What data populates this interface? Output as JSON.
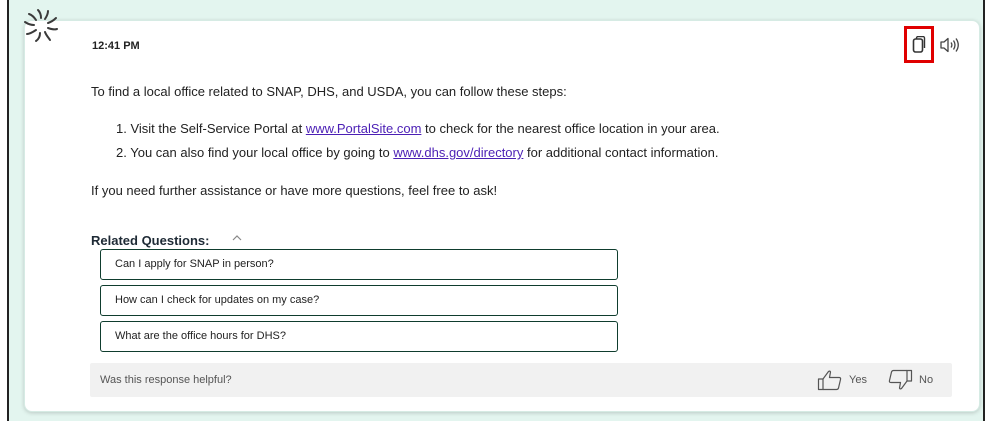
{
  "message": {
    "time": "12:41 PM",
    "intro": "To find a local office related to SNAP, DHS, and USDA, you can follow these steps:",
    "steps": [
      {
        "num": "1.",
        "before": "Visit the Self-Service Portal at ",
        "link": "www.PortalSite.com",
        "after": " to check for the nearest office location in your area."
      },
      {
        "num": "2.",
        "before": "You can also find your local office by going to ",
        "link": "www.dhs.gov/directory",
        "after": " for additional contact information."
      }
    ],
    "outro": "If you need further assistance or have more questions, feel free to ask!"
  },
  "related": {
    "title": "Related Questions:",
    "questions": [
      "Can I apply for SNAP in person?",
      "How can I check for updates on my case?",
      "What are the office hours for DHS?"
    ]
  },
  "feedback": {
    "prompt": "Was this response helpful?",
    "yes_label": "Yes",
    "no_label": "No"
  },
  "icons": {
    "logo": "sunburst-logo",
    "copy": "copy-icon",
    "speaker": "speaker-icon",
    "chevron": "chevron-up-icon",
    "thumbs_up": "thumbs-up-icon",
    "thumbs_down": "thumbs-down-icon"
  },
  "colors": {
    "highlight": "#e00000",
    "link": "#4b1fb5",
    "button_border": "#0f3d2e",
    "background_tint": "#e3f5ef"
  }
}
